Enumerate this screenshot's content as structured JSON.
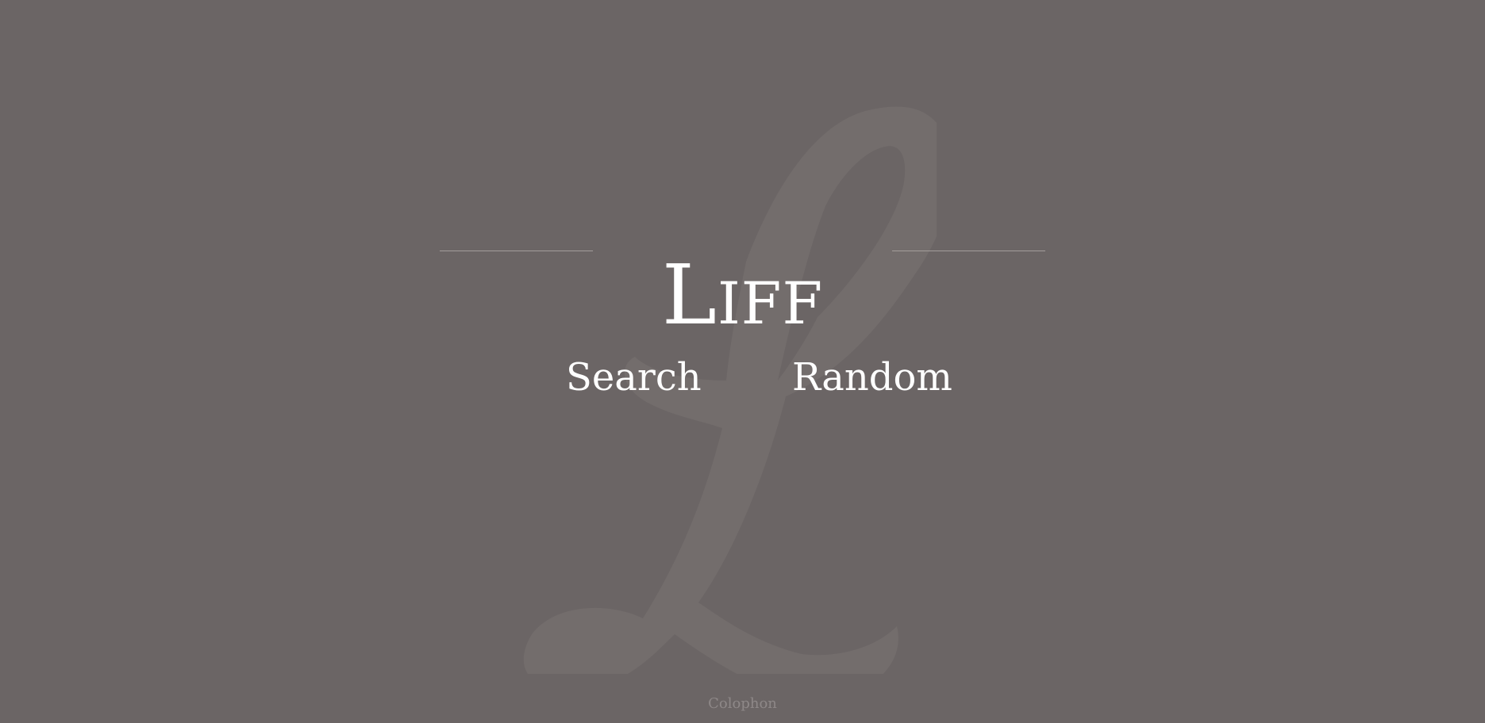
{
  "site": {
    "title": "Liff",
    "watermark_letter_icon": "script-l-icon"
  },
  "nav": {
    "search_label": "Search",
    "random_label": "Random"
  },
  "footer": {
    "colophon_label": "Colophon"
  },
  "colors": {
    "background": "#6b6565",
    "watermark": "#736d6c",
    "text": "#ffffff",
    "rule": "#a39d9b",
    "footer_text": "#8e8888"
  }
}
